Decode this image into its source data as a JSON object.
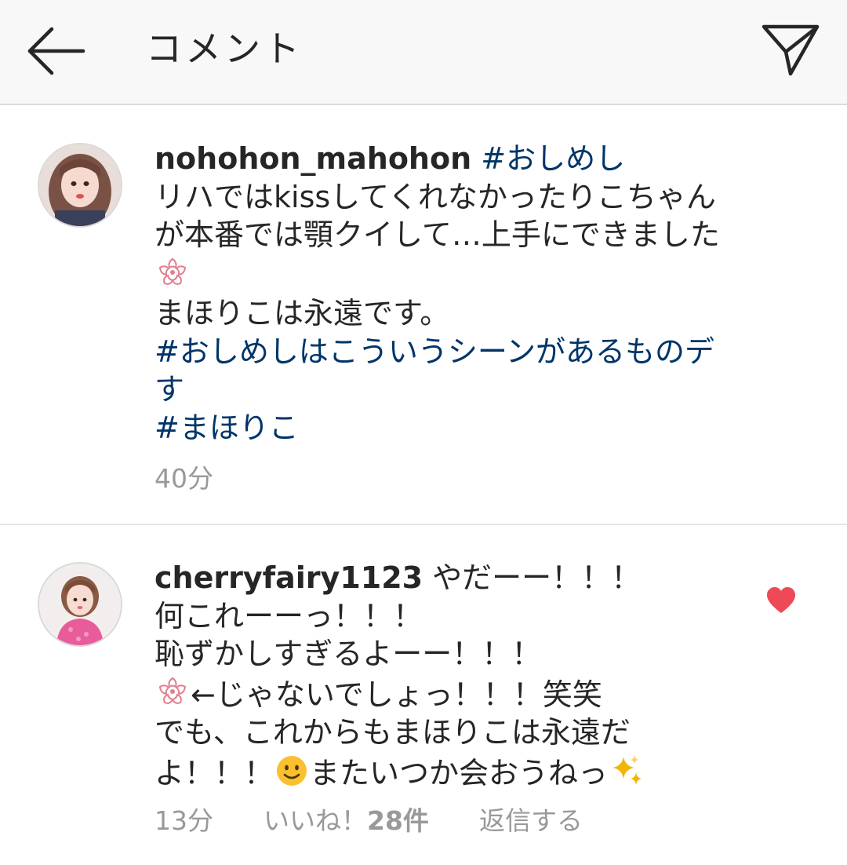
{
  "header": {
    "title": "コメント"
  },
  "caption": {
    "username": "nohohon_mahohon",
    "tag_inline": "#おしめし",
    "line1": "リハではkissしてくれなかったりこちゃん",
    "line2": "が本番では顎クイして…上手にできました",
    "line3": "まほりこは永遠です。",
    "tag1_part1": "#おしめしはこういうシーンがあるものデ",
    "tag1_part2": "す",
    "tag2": "#まほりこ",
    "time": "40分"
  },
  "reply": {
    "username": "cherryfairy1123",
    "line1_tail": "やだーー！！！",
    "line2": "何これーーっ！！！",
    "line3": "恥ずかしすぎるよーー！！！",
    "line4_tail": "←じゃないでしょっ！！！笑笑",
    "line5": "でも、これからもまほりこは永遠だ",
    "line6_head": "よ！！！",
    "line6_mid": "またいつか会おうねっ",
    "time": "13分",
    "likes_prefix": "いいね！",
    "likes_count": "28件",
    "reply_label": "返信する"
  },
  "icons": {
    "back": "back-arrow-icon",
    "send": "direct-send-icon",
    "heart": "heart-icon",
    "sakura": "cherry-blossom-icon",
    "smile": "smiling-face-icon",
    "sparkles": "sparkles-icon"
  },
  "colors": {
    "hashtag": "#003569",
    "heart": "#ed4956",
    "meta": "#999999",
    "appbar": "#f8f8f8"
  }
}
